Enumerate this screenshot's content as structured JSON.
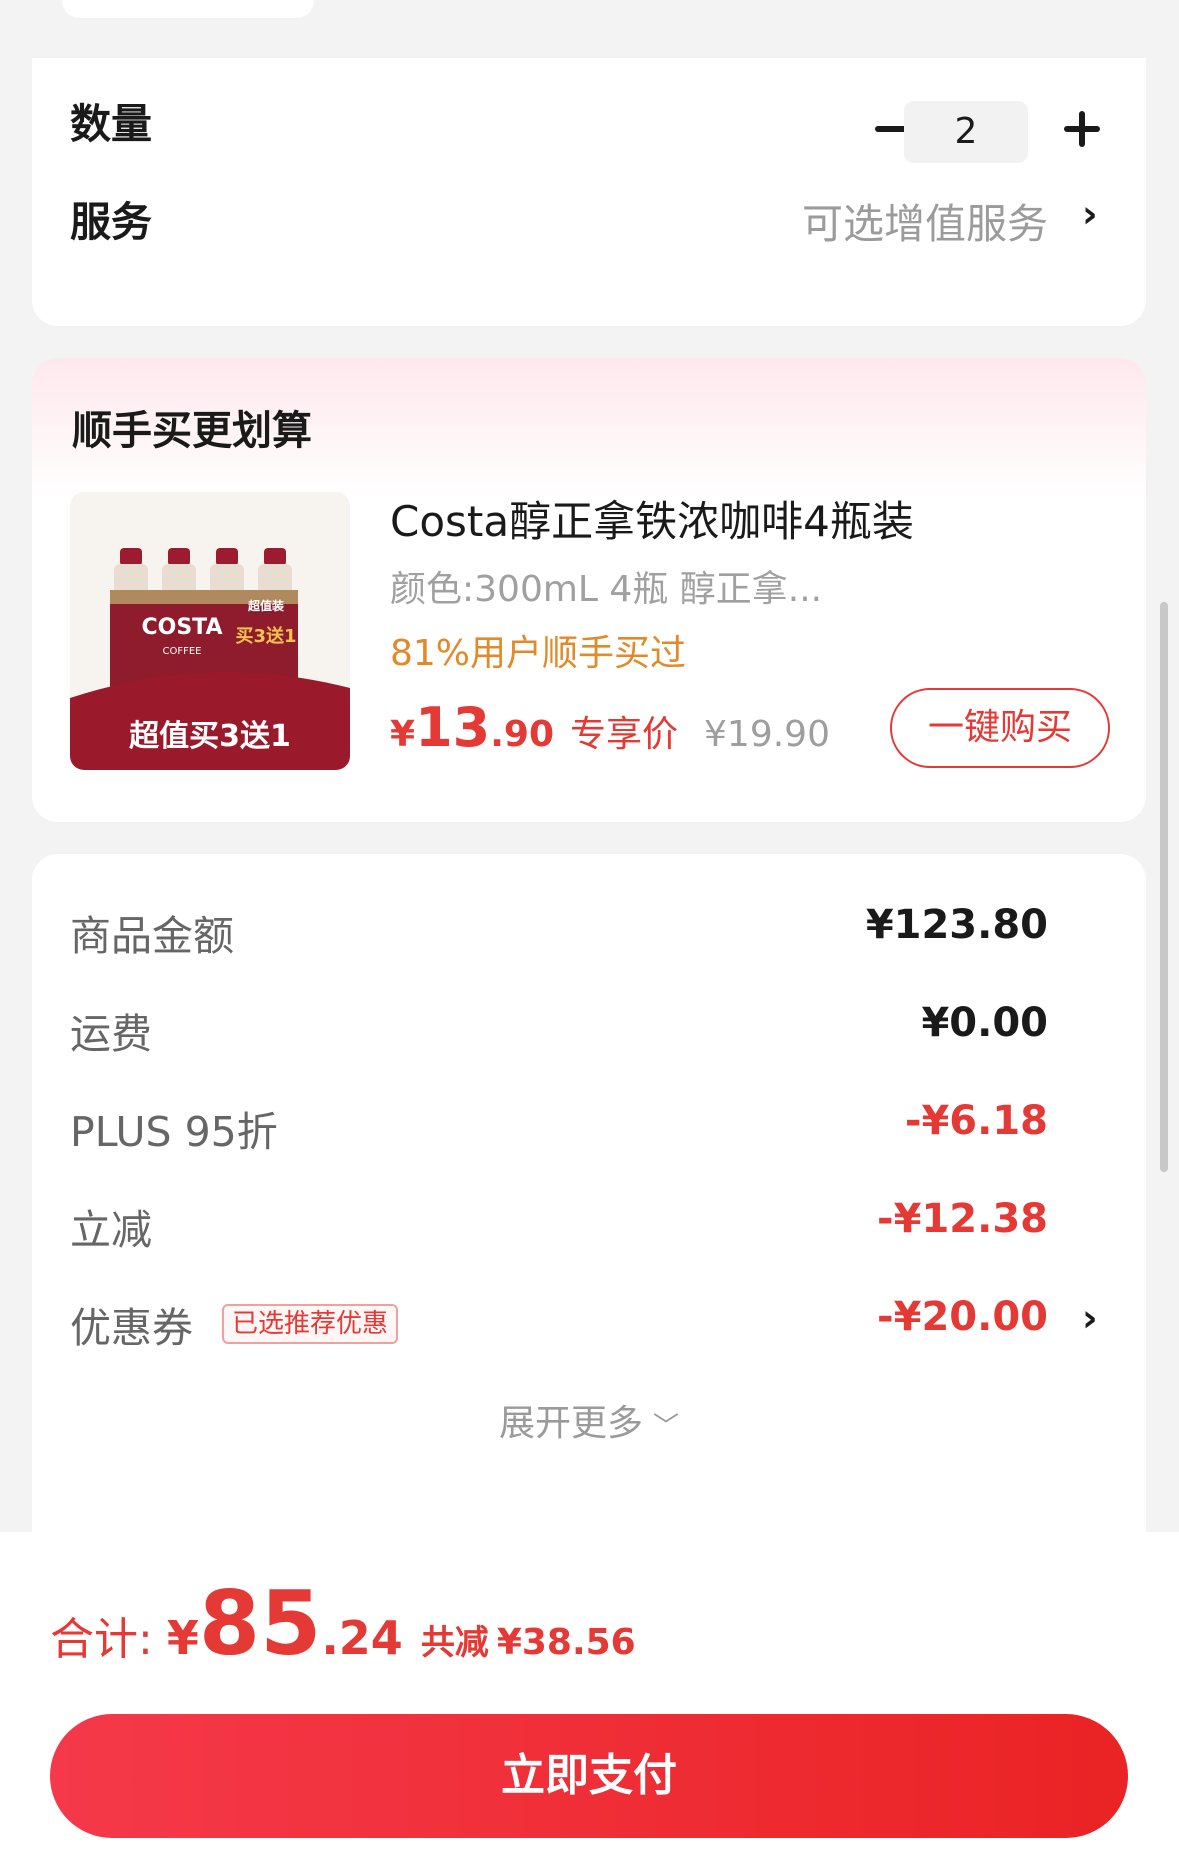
{
  "quantity": {
    "label": "数量",
    "value": "2"
  },
  "service": {
    "label": "服务",
    "value": "可选增值服务"
  },
  "bundle": {
    "title": "顺手买更划算",
    "product": {
      "name": "Costa醇正拿铁浓咖啡4瓶装",
      "spec": "颜色:300mL 4瓶  醇正拿...",
      "social_proof": "81%用户顺手买过",
      "price_symbol": "¥",
      "price_int": "13",
      "price_dec": ".90",
      "price_tag": "专享价",
      "original_price": "¥19.90",
      "image_text": {
        "brand": "COSTA",
        "sub": "COFFEE",
        "badge_top": "超值装",
        "badge_main": "买3送1",
        "banner": "超值买3送1"
      }
    },
    "buy_button": "一键购买"
  },
  "summary": {
    "rows": [
      {
        "label": "商品金额",
        "value": "¥123.80"
      },
      {
        "label": "运费",
        "value": "¥0.00"
      },
      {
        "label": "PLUS 95折",
        "value": "-¥6.18"
      },
      {
        "label": "立减",
        "value": "-¥12.38"
      },
      {
        "label": "优惠券",
        "value": "-¥20.00",
        "badge": "已选推荐优惠"
      }
    ],
    "expand_label": "展开更多"
  },
  "total": {
    "label": "合计:",
    "symbol": "¥",
    "int": "85",
    "dec": ".24",
    "saved_label": "共减",
    "saved_value": "¥38.56"
  },
  "pay_button": "立即支付",
  "colors": {
    "accent": "#e53935",
    "social": "#e08a2a"
  }
}
